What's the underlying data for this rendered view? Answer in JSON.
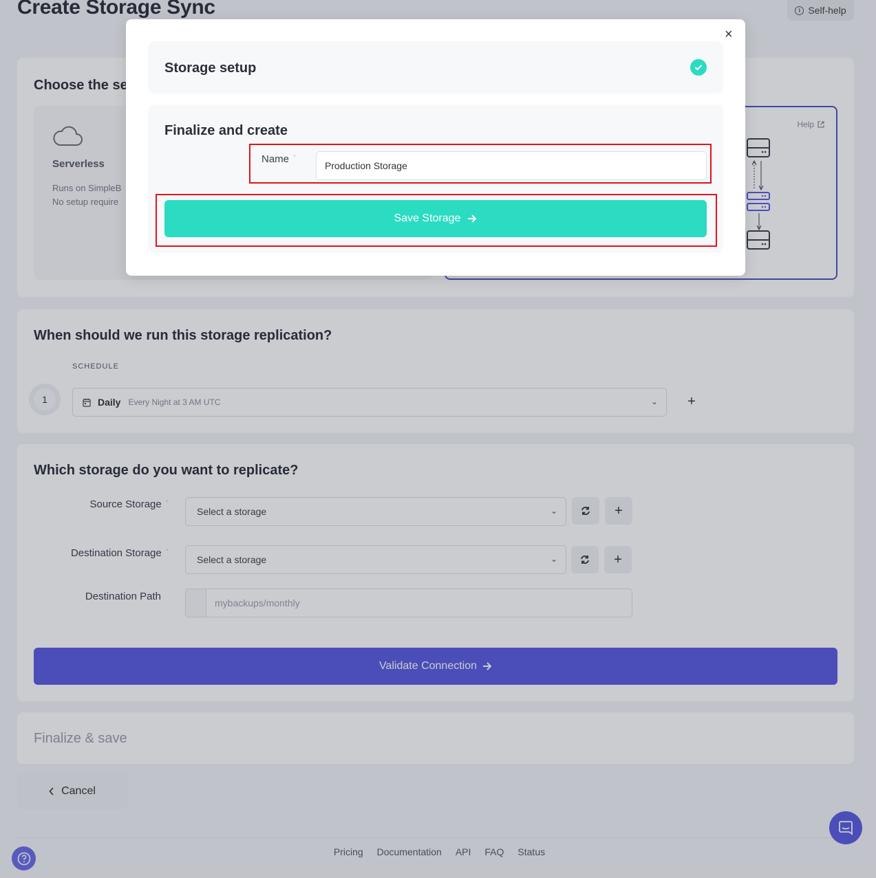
{
  "page": {
    "title": "Create Storage Sync",
    "self_help": "Self-help"
  },
  "section_method": {
    "heading": "Choose the ser",
    "serverless": {
      "title": "Serverless",
      "desc_line1": "Runs on SimpleB",
      "desc_line2": "No setup require"
    },
    "help_label": "Help"
  },
  "section_schedule": {
    "heading": "When should we run this storage replication?",
    "schedule_label": "SCHEDULE",
    "step_number": "1",
    "frequency": "Daily",
    "frequency_detail": "Every Night at 3 AM UTC"
  },
  "section_storage": {
    "heading": "Which storage do you want to replicate?",
    "source_label": "Source Storage",
    "source_value": "Select a storage",
    "destination_label": "Destination Storage",
    "destination_value": "Select a storage",
    "path_label": "Destination Path",
    "path_placeholder": "mybackups/monthly",
    "required_marker": "*",
    "validate_label": "Validate Connection"
  },
  "section_finalize": {
    "heading": "Finalize & save"
  },
  "cancel_label": "Cancel",
  "footer": {
    "links": [
      "Pricing",
      "Documentation",
      "API",
      "FAQ",
      "Status"
    ]
  },
  "modal": {
    "panel1_title": "Storage setup",
    "panel2_title": "Finalize and create",
    "name_label": "Name",
    "required_marker": "*",
    "name_value": "Production Storage",
    "save_label": "Save Storage"
  },
  "colors": {
    "accent_teal": "#2bdbc2",
    "accent_indigo": "#5a5ce0",
    "highlight_red": "#e0141c"
  }
}
